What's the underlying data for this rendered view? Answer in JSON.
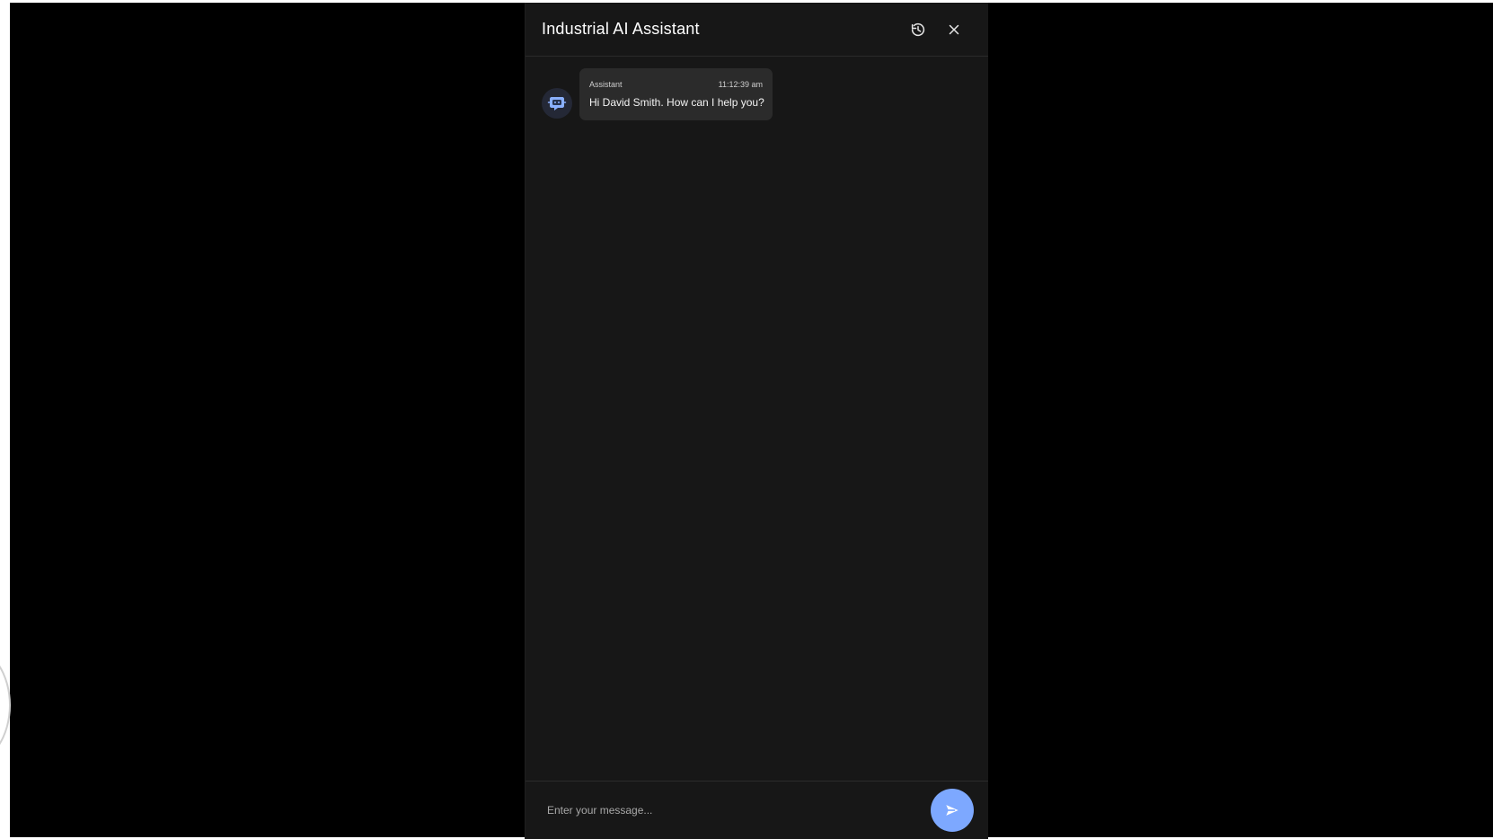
{
  "header": {
    "title": "Industrial AI Assistant",
    "history_icon": "history-icon",
    "close_icon": "close-icon"
  },
  "messages": [
    {
      "sender": "Assistant",
      "time": "11:12:39 am",
      "text": "Hi David Smith.  How can I help you?",
      "avatar_icon": "bot-chat-icon"
    }
  ],
  "composer": {
    "placeholder": "Enter your message...",
    "send_icon": "send-icon"
  },
  "colors": {
    "panel_background": "#171717",
    "bubble_background": "#2b2b2b",
    "accent": "#7da8ff"
  }
}
